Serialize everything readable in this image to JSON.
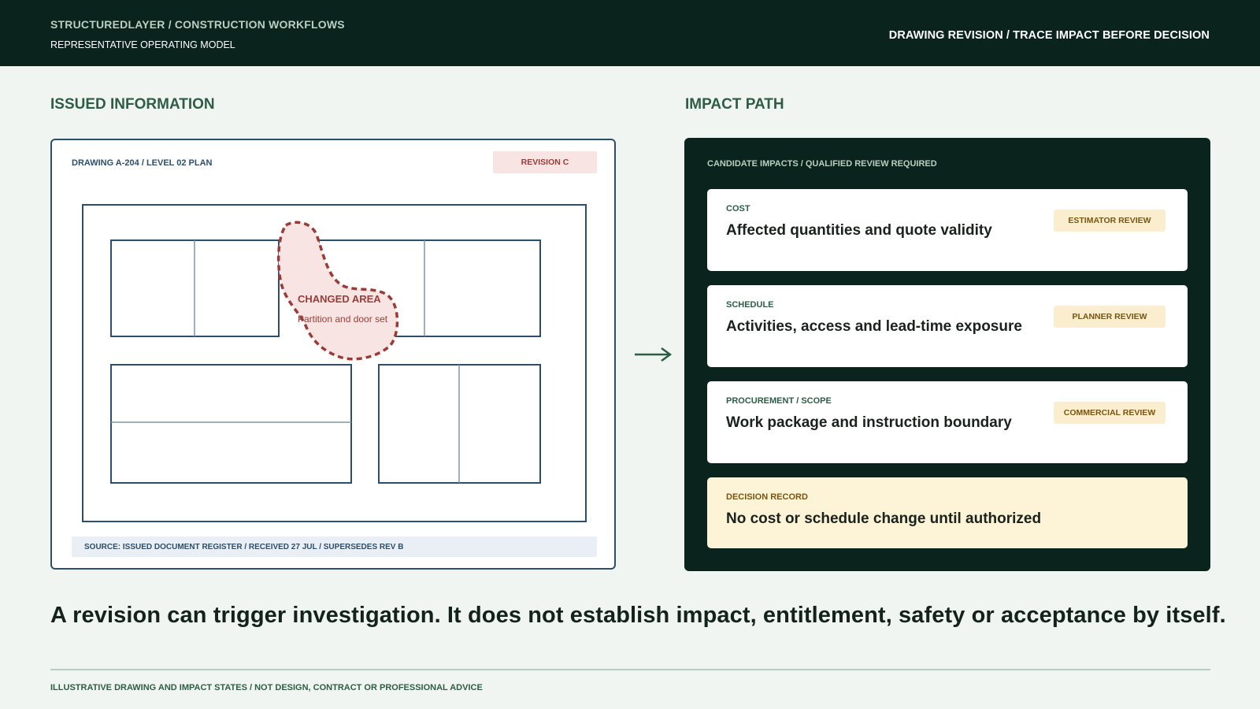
{
  "header": {
    "brand": "STRUCTUREDLAYER / CONSTRUCTION WORKFLOWS",
    "subtitle": "REPRESENTATIVE OPERATING MODEL",
    "context": "DRAWING REVISION / TRACE IMPACT BEFORE DECISION"
  },
  "issued": {
    "section_title": "ISSUED INFORMATION",
    "drawing_label": "DRAWING A-204 / LEVEL 02 PLAN",
    "revision_badge": "REVISION C",
    "changed_area": {
      "title": "CHANGED AREA",
      "detail": "Partition and door set"
    },
    "source": "SOURCE: ISSUED DOCUMENT REGISTER / RECEIVED 27 JUL / SUPERSEDES REV B"
  },
  "impact": {
    "section_title": "IMPACT PATH",
    "header": "CANDIDATE IMPACTS / QUALIFIED REVIEW REQUIRED",
    "items": [
      {
        "category": "COST",
        "description": "Affected quantities and quote validity",
        "review": "ESTIMATOR REVIEW"
      },
      {
        "category": "SCHEDULE",
        "description": "Activities, access and lead-time exposure",
        "review": "PLANNER REVIEW"
      },
      {
        "category": "PROCUREMENT / SCOPE",
        "description": "Work package and instruction boundary",
        "review": "COMMERCIAL REVIEW"
      }
    ],
    "decision": {
      "category": "DECISION RECORD",
      "description": "No cost or schedule change until authorized"
    }
  },
  "statement": "A revision can trigger investigation. It does not establish impact, entitlement, safety or acceptance by itself.",
  "footnote": "ILLUSTRATIVE DRAWING AND IMPACT STATES / NOT DESIGN, CONTRACT OR PROFESSIONAL ADVICE",
  "colors": {
    "dark_green": "#0a231c",
    "accent_green": "#2e5d45",
    "drawing_blue": "#2d4e6b",
    "change_red": "#9a3b38",
    "review_amber": "#fbeecf"
  }
}
